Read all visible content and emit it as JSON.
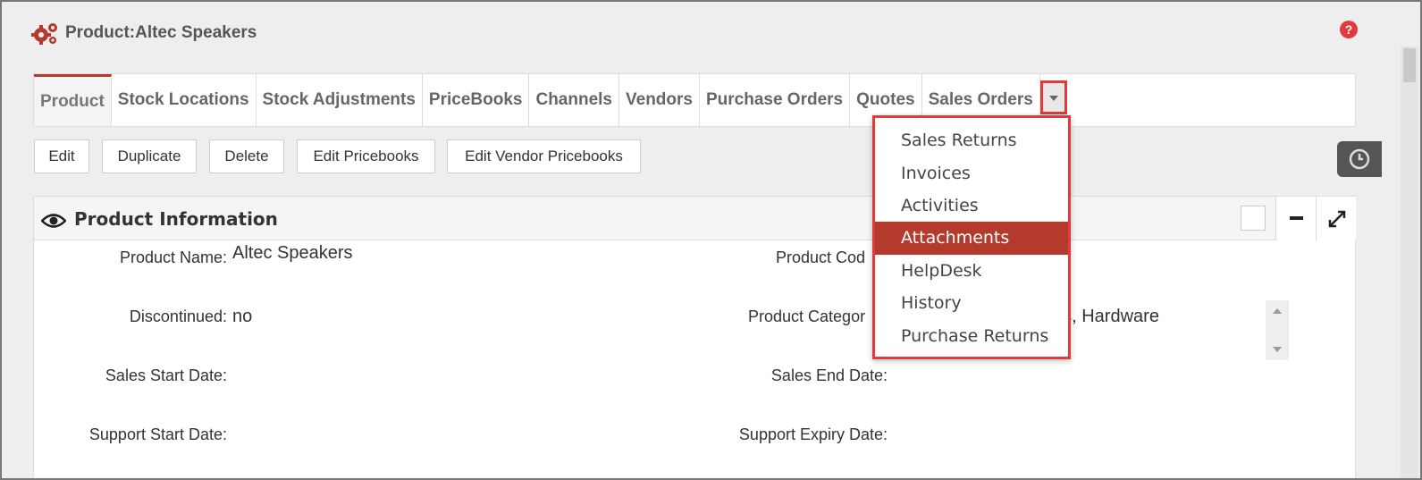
{
  "header": {
    "title": "Product:Altec Speakers"
  },
  "tabs": [
    {
      "label": "Product",
      "active": true
    },
    {
      "label": "Stock Locations"
    },
    {
      "label": "Stock Adjustments"
    },
    {
      "label": "PriceBooks"
    },
    {
      "label": "Channels"
    },
    {
      "label": "Vendors"
    },
    {
      "label": "Purchase Orders"
    },
    {
      "label": "Quotes"
    },
    {
      "label": "Sales Orders"
    }
  ],
  "actions": {
    "edit": "Edit",
    "duplicate": "Duplicate",
    "delete": "Delete",
    "edit_pricebooks": "Edit Pricebooks",
    "edit_vendor_pricebooks": "Edit Vendor Pricebooks"
  },
  "panel": {
    "title": "Product Information",
    "fields": {
      "product_name_label": "Product Name:",
      "product_name_value": "Altec Speakers",
      "product_code_label": "Product Cod",
      "discontinued_label": "Discontinued:",
      "discontinued_value": "no",
      "product_category_label": "Product Categor",
      "product_category_value": "es, Hardware",
      "sales_start_label": "Sales Start Date:",
      "sales_end_label": "Sales End Date:",
      "support_start_label": "Support Start Date:",
      "support_expiry_label": "Support Expiry Date:"
    }
  },
  "dropdown": {
    "items": [
      "Sales Returns",
      "Invoices",
      "Activities",
      "Attachments",
      "HelpDesk",
      "History",
      "Purchase Returns"
    ],
    "selected": "Attachments"
  },
  "colors": {
    "accent": "#b33a2c",
    "highlight_border": "#e03a3a"
  },
  "icons": [
    "gears-icon",
    "help-icon",
    "chevron-down-icon",
    "history-clock-icon",
    "eye-icon",
    "minimize-icon",
    "expand-icon"
  ]
}
